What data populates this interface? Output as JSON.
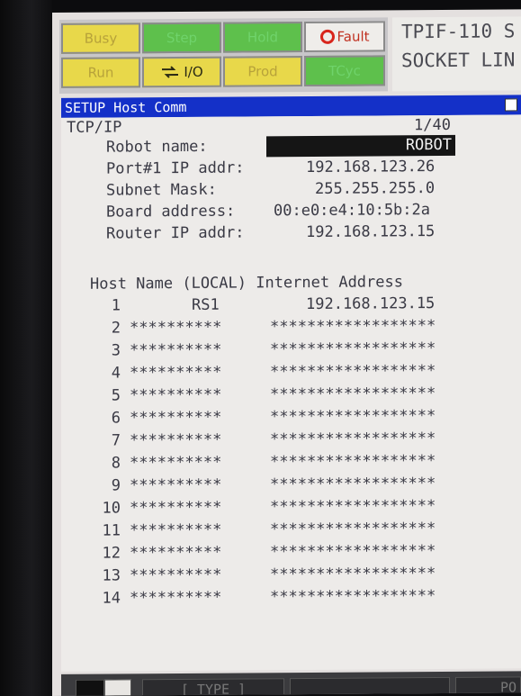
{
  "status_lamps": [
    {
      "label": "Busy"
    },
    {
      "label": "Step"
    },
    {
      "label": "Hold"
    },
    {
      "label": "Fault"
    },
    {
      "label": "Run"
    },
    {
      "label": "I/O"
    },
    {
      "label": "Prod"
    },
    {
      "label": "TCyc"
    }
  ],
  "info": {
    "line1": "TPIF-110 S",
    "line2": "SOCKET LIN"
  },
  "title": "SETUP Host Comm",
  "section": {
    "label": "TCP/IP",
    "page": "1/40"
  },
  "settings": [
    {
      "label": "Robot name:",
      "value": "ROBOT"
    },
    {
      "label": "Port#1 IP addr:",
      "value": "192.168.123.26"
    },
    {
      "label": "Subnet Mask:",
      "value": "255.255.255.0"
    },
    {
      "label": "Board address:",
      "value": "00:e0:e4:10:5b:2a"
    },
    {
      "label": "Router IP addr:",
      "value": "192.168.123.15"
    }
  ],
  "host_table": {
    "header": "Host Name (LOCAL) Internet Address",
    "rows": [
      {
        "num": "1",
        "name": "RS1",
        "addr": "192.168.123.15"
      },
      {
        "num": "2",
        "name": "**********",
        "addr": "******************"
      },
      {
        "num": "3",
        "name": "**********",
        "addr": "******************"
      },
      {
        "num": "4",
        "name": "**********",
        "addr": "******************"
      },
      {
        "num": "5",
        "name": "**********",
        "addr": "******************"
      },
      {
        "num": "6",
        "name": "**********",
        "addr": "******************"
      },
      {
        "num": "7",
        "name": "**********",
        "addr": "******************"
      },
      {
        "num": "8",
        "name": "**********",
        "addr": "******************"
      },
      {
        "num": "9",
        "name": "**********",
        "addr": "******************"
      },
      {
        "num": "10",
        "name": "**********",
        "addr": "******************"
      },
      {
        "num": "11",
        "name": "**********",
        "addr": "******************"
      },
      {
        "num": "12",
        "name": "**********",
        "addr": "******************"
      },
      {
        "num": "13",
        "name": "**********",
        "addr": "******************"
      },
      {
        "num": "14",
        "name": "**********",
        "addr": "******************"
      }
    ]
  },
  "function_keys": [
    {
      "label": ""
    },
    {
      "label": "[ TYPE ]"
    },
    {
      "label": ""
    },
    {
      "label": "PO"
    }
  ],
  "colors": {
    "titlebar": "#1430c8",
    "lamp_yellow": "#e8d84a",
    "lamp_green": "#5ec04c",
    "fault_red": "#d8251c"
  }
}
